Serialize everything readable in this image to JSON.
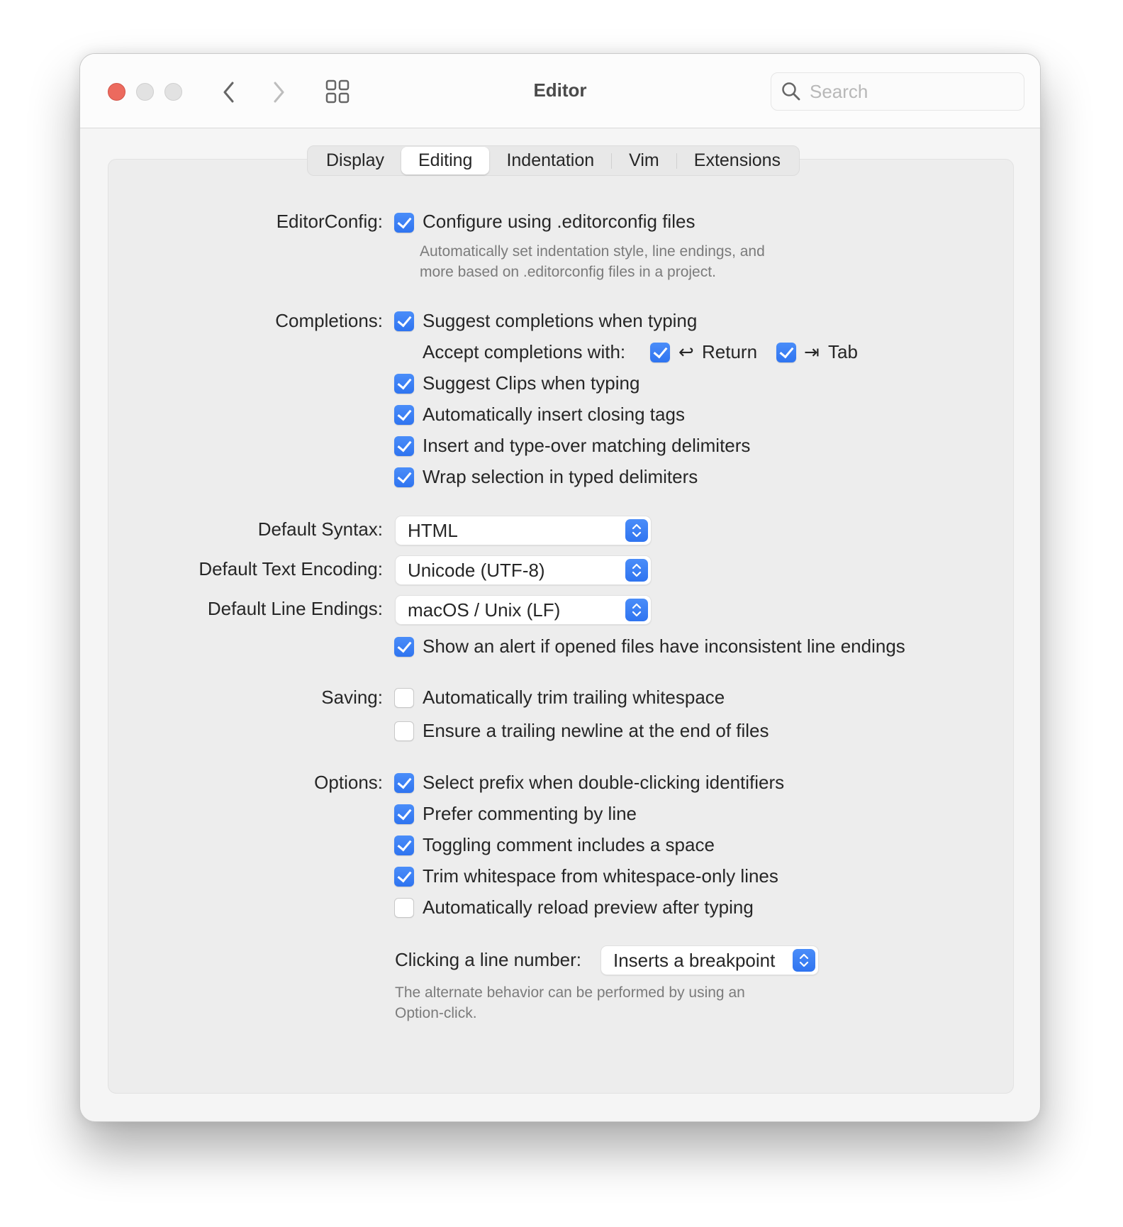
{
  "window": {
    "title": "Editor",
    "search": {
      "placeholder": "Search",
      "value": ""
    },
    "accent_color": "#3b82f6"
  },
  "tabs": [
    {
      "label": "Display",
      "selected": false
    },
    {
      "label": "Editing",
      "selected": true
    },
    {
      "label": "Indentation",
      "selected": false
    },
    {
      "label": "Vim",
      "selected": false
    },
    {
      "label": "Extensions",
      "selected": false
    }
  ],
  "editorconfig": {
    "label": "EditorConfig:",
    "option": {
      "label": "Configure using .editorconfig files",
      "checked": true
    },
    "help_line1": "Automatically set indentation style, line endings, and",
    "help_line2": "more based on .editorconfig files in a project."
  },
  "completions": {
    "label": "Completions:",
    "suggest": {
      "label": "Suggest completions when typing",
      "checked": true
    },
    "accept_label": "Accept completions with:",
    "accept_return": {
      "label": "Return",
      "symbol": "↩",
      "checked": true
    },
    "accept_tab": {
      "label": "Tab",
      "symbol": "⇥",
      "checked": true
    },
    "items": [
      {
        "label": "Suggest Clips when typing",
        "checked": true
      },
      {
        "label": "Automatically insert closing tags",
        "checked": true
      },
      {
        "label": "Insert and type-over matching delimiters",
        "checked": true
      },
      {
        "label": "Wrap selection in typed delimiters",
        "checked": true
      }
    ]
  },
  "defaults": {
    "syntax": {
      "label": "Default Syntax:",
      "value": "HTML"
    },
    "encoding": {
      "label": "Default Text Encoding:",
      "value": "Unicode (UTF-8)"
    },
    "line_endings": {
      "label": "Default Line Endings:",
      "value": "macOS / Unix (LF)"
    },
    "alert": {
      "label": "Show an alert if opened files have inconsistent line endings",
      "checked": true
    }
  },
  "saving": {
    "label": "Saving:",
    "items": [
      {
        "label": "Automatically trim trailing whitespace",
        "checked": false
      },
      {
        "label": "Ensure a trailing newline at the end of files",
        "checked": false
      }
    ]
  },
  "options": {
    "label": "Options:",
    "items": [
      {
        "label": "Select prefix when double-clicking identifiers",
        "checked": true
      },
      {
        "label": "Prefer commenting by line",
        "checked": true
      },
      {
        "label": "Toggling comment includes a space",
        "checked": true
      },
      {
        "label": "Trim whitespace from whitespace-only lines",
        "checked": true
      },
      {
        "label": "Automatically reload preview after typing",
        "checked": false
      }
    ]
  },
  "line_number": {
    "label": "Clicking a line number:",
    "value": "Inserts a breakpoint",
    "help_line1": "The alternate behavior can be performed by using an",
    "help_line2": "Option-click."
  }
}
